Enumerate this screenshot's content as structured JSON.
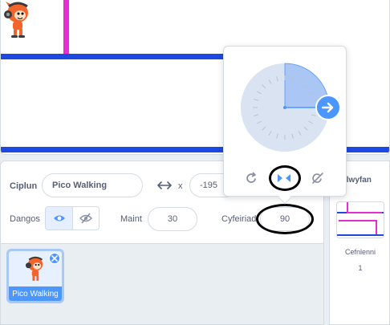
{
  "sprite": {
    "label": "Ciplun",
    "name": "Pico Walking",
    "x_label": "x",
    "x_value": "-195",
    "show_label": "Dangos",
    "size_label": "Maint",
    "size_value": "30",
    "direction_label": "Cyfeiriad",
    "direction_value": "90"
  },
  "sprite_list": [
    {
      "name": "Pico Walking",
      "selected": true
    }
  ],
  "stage_pane": {
    "title_fragment": "llwyfan",
    "backdrops_label": "Cefnlenni",
    "backdrops_count": "1"
  },
  "direction_popover": {
    "direction_degrees": 90,
    "rotation_styles": [
      "all-around",
      "left-right",
      "dont-rotate"
    ],
    "selected_style": "left-right"
  },
  "colors": {
    "accent_blue": "#4c97ff",
    "stage_line_blue": "#1d49e0",
    "stage_line_magenta": "#e52ecf",
    "ellipse": "#000000"
  },
  "icons": {
    "xy": "arrows-horizontal-icon",
    "show": "eye-icon",
    "hide": "eye-slash-icon",
    "delete": "close-icon",
    "direction_handle": "arrow-right-icon",
    "rotate_all": "rotate-icon",
    "rotate_lr": "flip-horizontal-icon",
    "no_rotate": "no-rotate-icon"
  }
}
